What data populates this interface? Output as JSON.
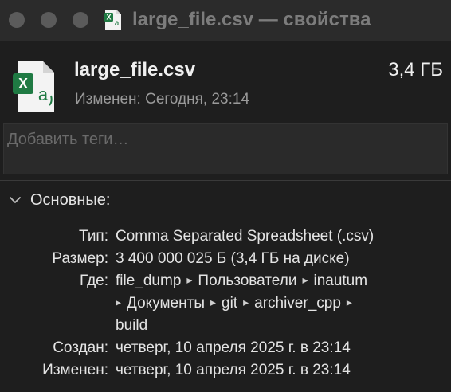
{
  "window": {
    "title": "large_file.csv — свойства"
  },
  "header": {
    "file_name": "large_file.csv",
    "file_size": "3,4 ГБ",
    "modified": "Изменен: Сегодня, 23:14"
  },
  "tags": {
    "placeholder": "Добавить теги…"
  },
  "general": {
    "title": "Основные:",
    "type_label": "Тип:",
    "type_value": "Comma Separated Spreadsheet (.csv)",
    "size_label": "Размер:",
    "size_value": "3 400 000 025 Б (3,4 ГБ на диске)",
    "where_label": "Где:",
    "path": [
      "file_dump",
      "Пользователи",
      "inautum",
      "Документы",
      "git",
      "archiver_cpp",
      "build"
    ],
    "created_label": "Создан:",
    "created_value": "четверг, 10 апреля 2025 г. в 23:14",
    "modified_label": "Изменен:",
    "modified_value": "четверг, 10 апреля 2025 г. в 23:14"
  },
  "icons": {
    "file": "excel-csv-file-icon",
    "path_separator": "▸",
    "disclosure": "chevron-down-icon"
  },
  "colors": {
    "excel_green": "#1f7a43",
    "window_bg": "#1e1e1e",
    "titlebar_bg": "#2b2b2b"
  }
}
